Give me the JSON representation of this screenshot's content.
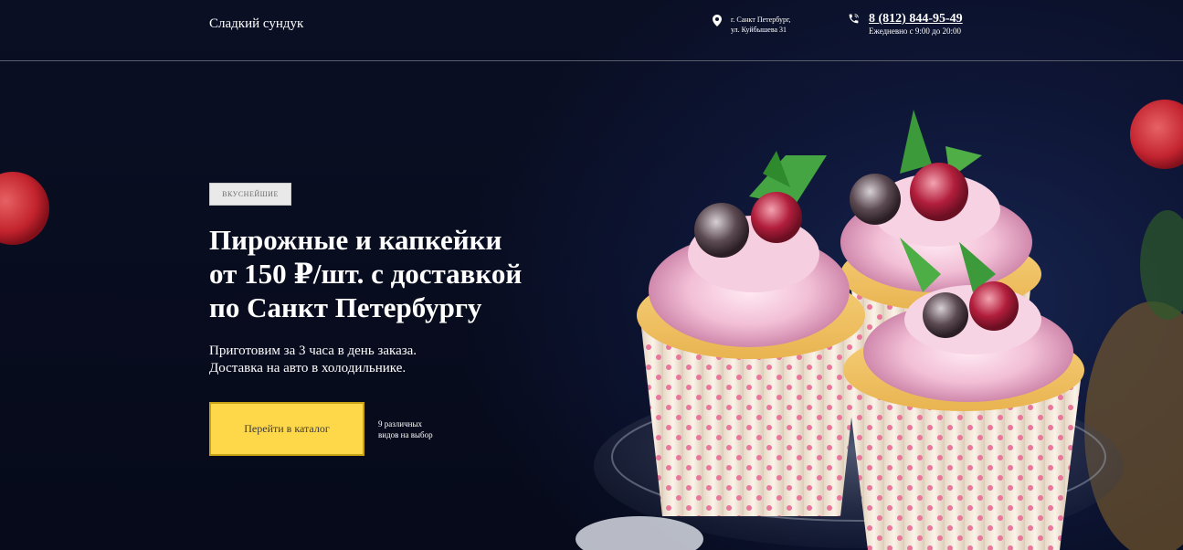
{
  "header": {
    "logo": "Сладкий сундук",
    "address_line1": "г. Санкт Петербург,",
    "address_line2": "ул. Куйбышева 31",
    "phone": "8 (812) 844-95-49",
    "hours": "Ежедневно с 9:00 до 20:00"
  },
  "hero": {
    "badge": "ВКУСНЕЙШИЕ",
    "title_line1": "Пирожные и капкейки",
    "title_line2": "от 150 ₽/шт. с доставкой",
    "title_line3": "по Санкт Петербургу",
    "subtitle_line1": "Приготовим за 3 часа в день заказа.",
    "subtitle_line2": "Доставка на авто в холодильнике.",
    "cta_label": "Перейти в каталог",
    "cta_note_line1": "9 различных",
    "cta_note_line2": "видов на выбор"
  },
  "colors": {
    "background": "#070b1c",
    "accent_button": "#ffd84a",
    "berry": "#e0323a",
    "cupcake_liner_dot": "#e8779b"
  },
  "icons": {
    "address": "map-pin-icon",
    "phone": "phone-icon"
  }
}
